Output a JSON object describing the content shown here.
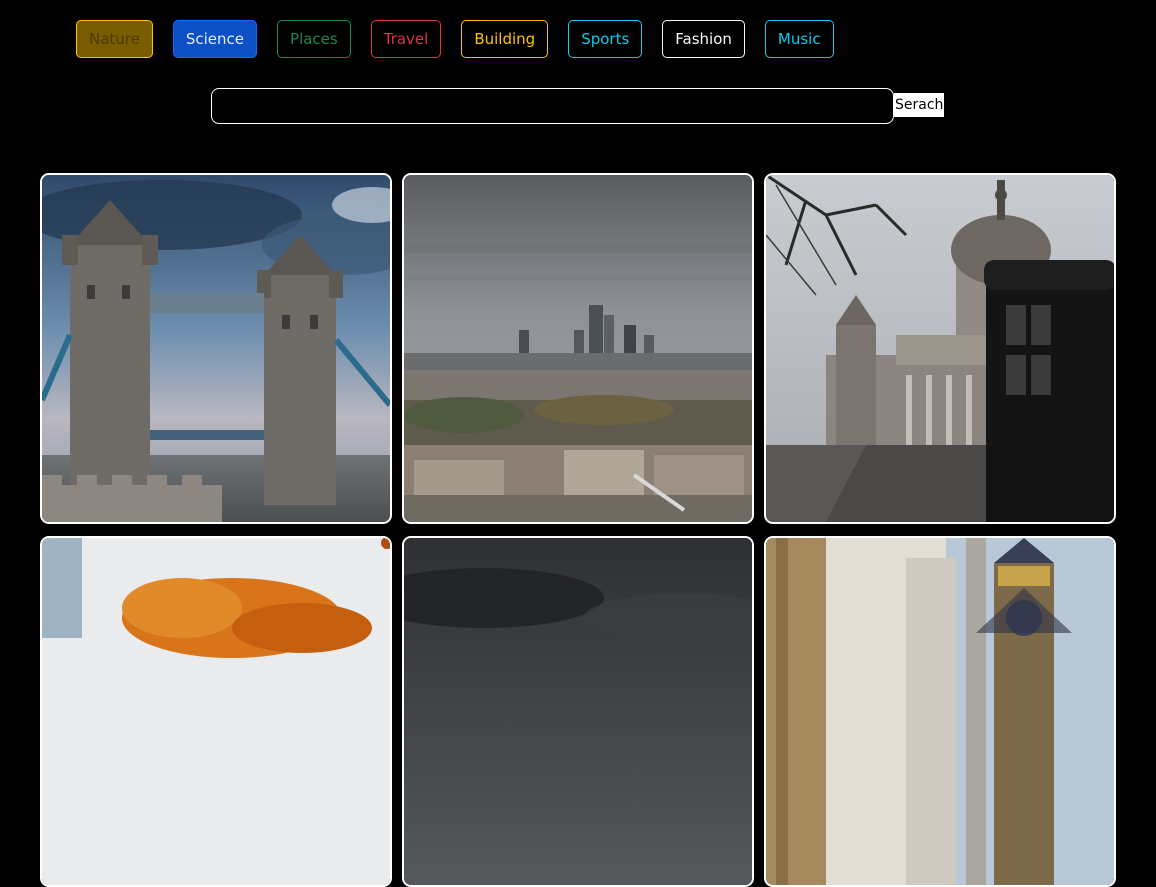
{
  "categories": [
    {
      "label": "Nature"
    },
    {
      "label": "Science"
    },
    {
      "label": "Places"
    },
    {
      "label": "Travel"
    },
    {
      "label": "Building"
    },
    {
      "label": "Sports"
    },
    {
      "label": "Fashion"
    },
    {
      "label": "Music"
    }
  ],
  "search": {
    "value": "",
    "placeholder": "",
    "button_label": "Serach"
  },
  "gallery": {
    "images": [
      {
        "subject": "tower-bridge"
      },
      {
        "subject": "london-skyline"
      },
      {
        "subject": "st-pauls-cathedral"
      },
      {
        "subject": "autumn-leaves"
      },
      {
        "subject": "stormy-sky"
      },
      {
        "subject": "big-ben"
      }
    ]
  },
  "colors": {
    "background": "#000000",
    "border": "#ffffff"
  }
}
